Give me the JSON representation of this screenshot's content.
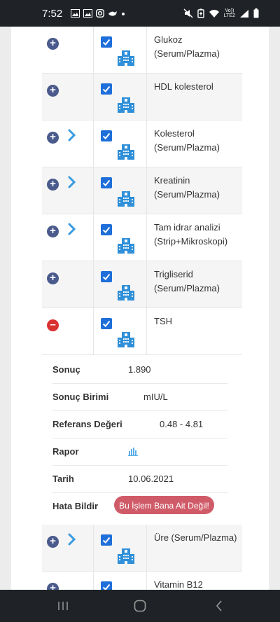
{
  "status_bar": {
    "time": "7:52",
    "volte": "Vo))\nLTE2"
  },
  "tests": [
    {
      "name": "Glukoz (Serum/Plazma)",
      "expand": "plus",
      "chevron": false,
      "checked": true
    },
    {
      "name": "HDL kolesterol",
      "expand": "plus",
      "chevron": false,
      "checked": true
    },
    {
      "name": "Kolesterol (Serum/Plazma)",
      "expand": "plus",
      "chevron": true,
      "checked": true
    },
    {
      "name": "Kreatinin (Serum/Plazma)",
      "expand": "plus",
      "chevron": true,
      "checked": true
    },
    {
      "name": "Tam idrar analizi (Strip+Mikroskopi)",
      "expand": "plus",
      "chevron": true,
      "checked": true
    },
    {
      "name": "Trigliserid (Serum/Plazma)",
      "expand": "plus",
      "chevron": false,
      "checked": true
    },
    {
      "name": "TSH",
      "expand": "minus",
      "chevron": false,
      "checked": true
    }
  ],
  "tests_after": [
    {
      "name": "Üre (Serum/Plazma)",
      "expand": "plus",
      "chevron": true,
      "checked": true
    },
    {
      "name": "Vitamin B12",
      "expand": "plus",
      "chevron": false,
      "checked": true
    }
  ],
  "detail": {
    "sonuc_label": "Sonuç",
    "sonuc_value": "1.890",
    "birim_label": "Sonuç Birimi",
    "birim_value": "mIU/L",
    "referans_label": "Referans Değeri",
    "referans_value": "0.48 - 4.81",
    "rapor_label": "Rapor",
    "tarih_label": "Tarih",
    "tarih_value": "10.06.2021",
    "hata_label": "Hata Bildir",
    "hata_button": "Bu İşlem Bana Ait Değil!"
  },
  "colors": {
    "toggle_plus": "#4a5a8c",
    "toggle_minus": "#d9312f",
    "checkbox": "#1e6fd9",
    "building_icon": "#2f8fd8",
    "chevron": "#3a9be0",
    "error_button": "#d05b68"
  },
  "icons": {
    "expand": "plus-circle-icon",
    "collapse": "minus-circle-icon",
    "chevron": "chevron-right-icon",
    "hospital": "hospital-building-icon",
    "report": "bar-chart-icon"
  }
}
